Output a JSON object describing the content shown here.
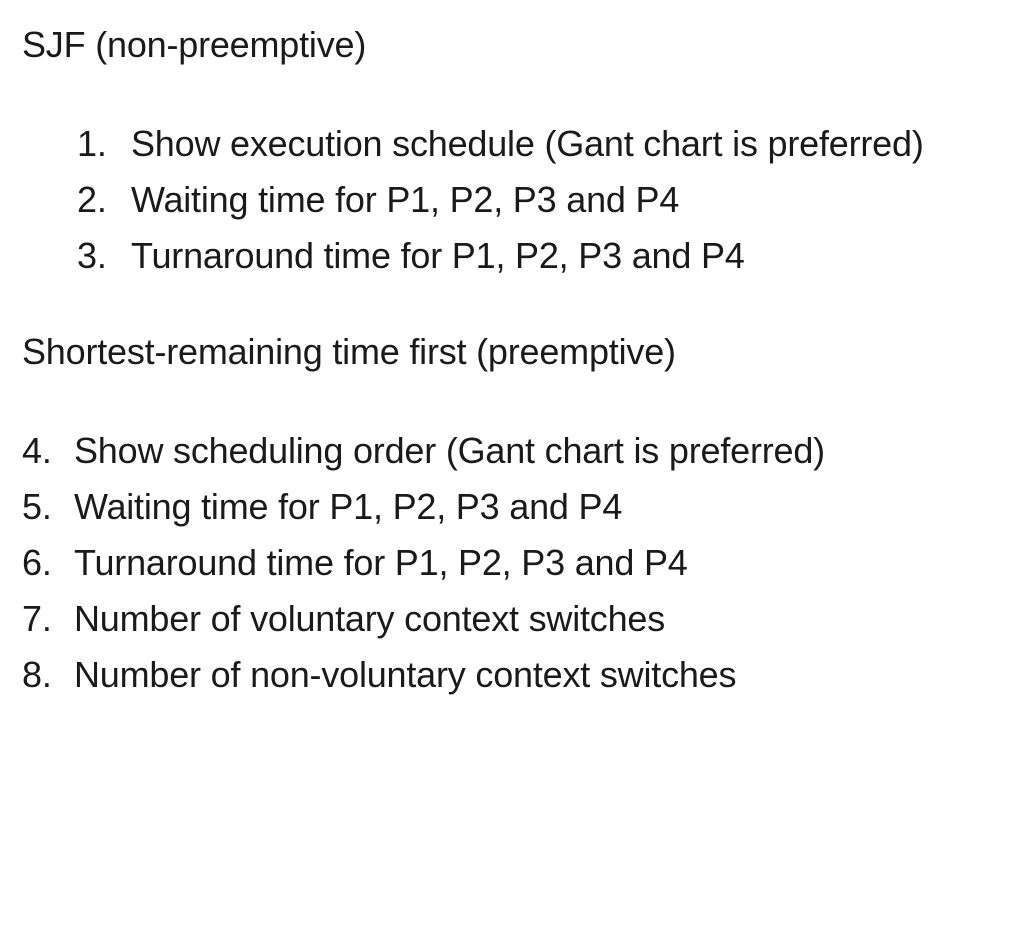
{
  "section1": {
    "title": "SJF (non-preemptive)",
    "items": [
      "Show execution schedule (Gant chart is preferred)",
      "Waiting time for P1, P2, P3 and P4",
      "Turnaround time for P1, P2, P3 and P4"
    ]
  },
  "section2": {
    "title": "Shortest-remaining time first (preemptive)",
    "items": [
      "Show scheduling order (Gant chart is preferred)",
      "Waiting time for P1, P2, P3 and P4",
      "Turnaround time for P1, P2, P3 and P4",
      "Number of voluntary context switches",
      "Number of non-voluntary context switches"
    ]
  }
}
